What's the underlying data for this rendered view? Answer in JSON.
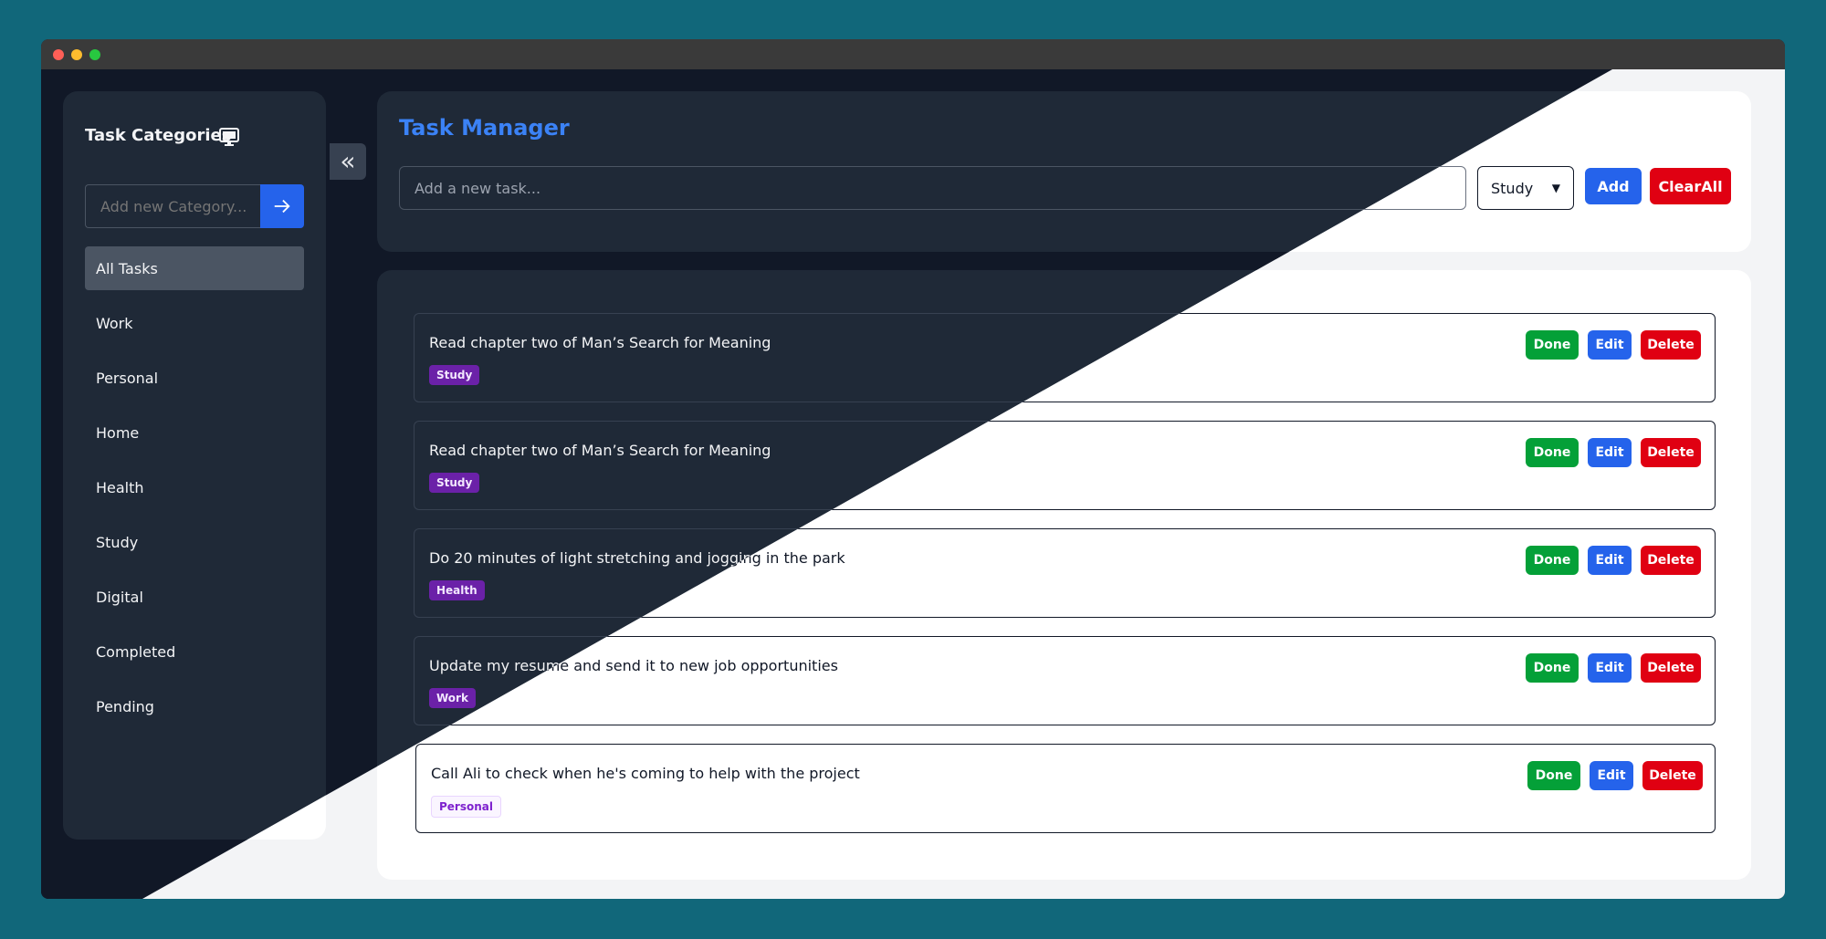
{
  "sidebar": {
    "title": "Task Categories",
    "category_input_placeholder": "Add new Category...",
    "items": [
      {
        "label": "All Tasks",
        "active": true
      },
      {
        "label": "Work"
      },
      {
        "label": "Personal"
      },
      {
        "label": "Home"
      },
      {
        "label": "Health"
      },
      {
        "label": "Study"
      },
      {
        "label": "Digital"
      },
      {
        "label": "Completed"
      },
      {
        "label": "Pending"
      }
    ]
  },
  "header": {
    "title": "Task Manager",
    "task_input_placeholder": "Add a new task...",
    "selected_category": "Study",
    "add_label": "Add",
    "clear_label": "ClearAll"
  },
  "tasks": [
    {
      "text": "Read chapter two of Man’s Search for Meaning",
      "category": "Study"
    },
    {
      "text": "Read chapter two of Man’s Search for Meaning",
      "category": "Study"
    },
    {
      "text": "Do 20 minutes of light stretching and jogging in the park",
      "category": "Health"
    },
    {
      "text": "Update my resume and send it to new job opportunities",
      "category": "Work"
    },
    {
      "text": "Call Ali to check when he's coming to help with the project",
      "category": "Personal"
    }
  ],
  "task_actions": {
    "done": "Done",
    "edit": "Edit",
    "delete": "Delete"
  },
  "colors": {
    "brand_blue": "#2563eb",
    "danger_red": "#e00012",
    "success_green": "#04a038",
    "badge_purple": "#6b21a8",
    "dark_bg": "#111827",
    "dark_panel": "#1f2937",
    "light_panel": "#ffffff"
  },
  "icons": {
    "sidebar_header": "monitor-icon",
    "collapse": "double-chevron-left-icon",
    "category_submit": "arrow-right-icon"
  }
}
